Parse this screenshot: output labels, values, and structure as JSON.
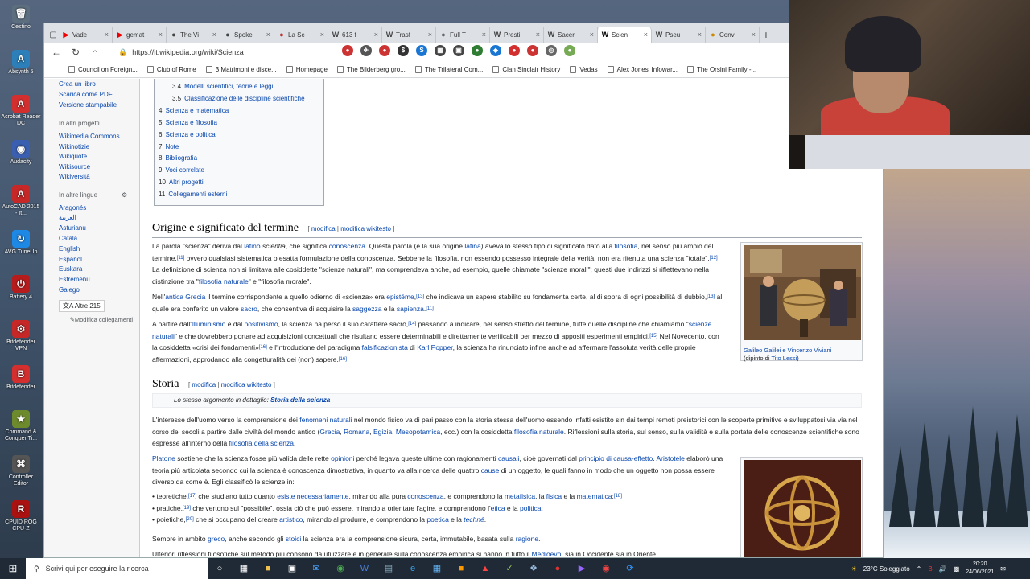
{
  "desktop": {
    "icons": [
      {
        "label": "Cestino",
        "icon": "recycle-bin-icon",
        "color": "#5d6f7f",
        "glyph": "🗑"
      },
      {
        "label": "Absynth 5",
        "icon": "absynth-icon",
        "color": "#2c7fb8",
        "glyph": "A"
      },
      {
        "label": "Acrobat Reader DC",
        "icon": "acrobat-icon",
        "color": "#d32f2f",
        "glyph": "A"
      },
      {
        "label": "Audacity",
        "icon": "audacity-icon",
        "color": "#3a5fb0",
        "glyph": "◉"
      },
      {
        "label": "AutoCAD 2015 - It...",
        "icon": "autocad-icon",
        "color": "#c62828",
        "glyph": "A"
      },
      {
        "label": "AVG TuneUp",
        "icon": "avg-icon",
        "color": "#1e88e5",
        "glyph": "↻"
      },
      {
        "label": "Battery 4",
        "icon": "battery-icon",
        "color": "#b71c1c",
        "glyph": "⏻"
      },
      {
        "label": "Bitdefender VPN",
        "icon": "bitdefender-vpn-icon",
        "color": "#c62828",
        "glyph": "⚙"
      },
      {
        "label": "Bitdefender",
        "icon": "bitdefender-icon",
        "color": "#d32f2f",
        "glyph": "B"
      },
      {
        "label": "Command & Conquer Ti...",
        "icon": "command-conquer-icon",
        "color": "#6d8a2c",
        "glyph": "★"
      },
      {
        "label": "Controller Editor",
        "icon": "controller-editor-icon",
        "color": "#555",
        "glyph": "⌘"
      },
      {
        "label": "CPUID ROG CPU-Z",
        "icon": "cpuz-icon",
        "color": "#a11",
        "glyph": "R"
      }
    ]
  },
  "browser": {
    "tabs": [
      {
        "title": "Vade",
        "icon": "youtube-icon",
        "color": "#e00"
      },
      {
        "title": "gemat",
        "icon": "youtube-icon",
        "color": "#e00"
      },
      {
        "title": "The Vi",
        "icon": "page-icon",
        "color": "#444"
      },
      {
        "title": "Spoke",
        "icon": "gear-icon",
        "color": "#444"
      },
      {
        "title": "La Sc",
        "icon": "site-icon",
        "color": "#b33"
      },
      {
        "title": "613 f",
        "icon": "wikipedia-icon",
        "color": "#444"
      },
      {
        "title": "Trasf",
        "icon": "wikipedia-icon",
        "color": "#444"
      },
      {
        "title": "Full T",
        "icon": "page-icon",
        "color": "#666"
      },
      {
        "title": "Presti",
        "icon": "wikipedia-icon",
        "color": "#444"
      },
      {
        "title": "Sacer",
        "icon": "wikipedia-icon",
        "color": "#444"
      },
      {
        "title": "Scien",
        "icon": "wikipedia-icon",
        "color": "#000",
        "active": true
      },
      {
        "title": "Pseu",
        "icon": "wikipedia-icon",
        "color": "#444"
      },
      {
        "title": "Conv",
        "icon": "site-icon",
        "color": "#c80"
      }
    ],
    "url": "https://it.wikipedia.org/wiki/Scienza",
    "extensions": [
      {
        "name": "ext-1",
        "color": "#c33",
        "g": "●"
      },
      {
        "name": "ext-2",
        "color": "#555",
        "g": "✈"
      },
      {
        "name": "ext-3",
        "color": "#c33",
        "g": "●"
      },
      {
        "name": "ext-4",
        "color": "#333",
        "g": "$"
      },
      {
        "name": "ext-5",
        "color": "#1976d2",
        "g": "S"
      },
      {
        "name": "ext-6",
        "color": "#444",
        "g": "▦"
      },
      {
        "name": "ext-7",
        "color": "#444",
        "g": "▣"
      },
      {
        "name": "ext-8",
        "color": "#2e7d32",
        "g": "●"
      },
      {
        "name": "ext-9",
        "color": "#1976d2",
        "g": "◆"
      },
      {
        "name": "ext-10",
        "color": "#d32f2f",
        "g": "●"
      },
      {
        "name": "ext-11",
        "color": "#c33",
        "g": "●"
      },
      {
        "name": "ext-12",
        "color": "#666",
        "g": "◎"
      },
      {
        "name": "ext-13",
        "color": "#7a5",
        "g": "●"
      }
    ],
    "bookmarks": [
      "Council on Foreign...",
      "Club of Rome",
      "3 Matrimoni e disce...",
      "Homepage",
      "The Bilderberg gro...",
      "The Trilateral Com...",
      "Clan Sinclair History",
      "Vedas",
      "Alex Jones' Infowar...",
      "The Orsini Family -..."
    ]
  },
  "sidebar": {
    "print_links": [
      "Crea un libro",
      "Scarica come PDF",
      "Versione stampabile"
    ],
    "other_projects_heading": "In altri progetti",
    "other_projects": [
      "Wikimedia Commons",
      "Wikinotizie",
      "Wikiquote",
      "Wikisource",
      "Wikiversità"
    ],
    "languages_heading": "In altre lingue",
    "languages": [
      "Aragonés",
      "العربية",
      "Asturianu",
      "Català",
      "English",
      "Español",
      "Euskara",
      "Estremeñu",
      "Galego"
    ],
    "more_languages": "Altre 215",
    "edit_links": "Modifica collegamenti"
  },
  "toc": {
    "items": [
      {
        "num": "3.4",
        "label": "Modelli scientifici, teorie e leggi",
        "indent": true
      },
      {
        "num": "3.5",
        "label": "Classificazione delle discipline scientifiche",
        "indent": true
      },
      {
        "num": "4",
        "label": "Scienza e matematica"
      },
      {
        "num": "5",
        "label": "Scienza e filosofia"
      },
      {
        "num": "6",
        "label": "Scienza e politica"
      },
      {
        "num": "7",
        "label": "Note"
      },
      {
        "num": "8",
        "label": "Bibliografia"
      },
      {
        "num": "9",
        "label": "Voci correlate"
      },
      {
        "num": "10",
        "label": "Altri progetti"
      },
      {
        "num": "11",
        "label": "Collegamenti esterni"
      }
    ]
  },
  "sections": {
    "origine_title": "Origine e significato del termine",
    "storia_title": "Storia",
    "edit": "modifica",
    "edit_source": "modifica wikitesto",
    "hatnote_prefix": "Lo stesso argomento in dettaglio:",
    "hatnote_link": "Storia della scienza"
  },
  "figures": {
    "galileo_caption": "Galileo Galilei e Vincenzo Viviani",
    "galileo_sub": "(dipinto di ",
    "galileo_author": "Tito Lessi",
    "galileo_close": ")"
  },
  "taskbar": {
    "search_placeholder": "Scrivi qui per eseguire la ricerca",
    "weather": "23°C Soleggiato",
    "time": "20:20",
    "date": "24/06/2021"
  }
}
